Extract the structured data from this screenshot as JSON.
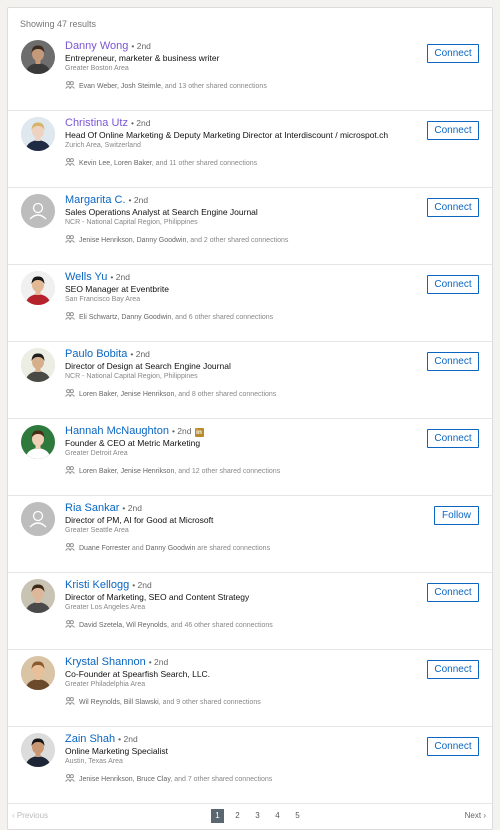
{
  "results_label": "Showing 47 results",
  "people": [
    {
      "name": "Danny Wong",
      "degree": "• 2nd",
      "headline": "Entrepreneur, marketer & business writer",
      "location": "Greater Boston Area",
      "shared_names": "Evan Weber, Josh Steimle",
      "shared_rest": ", and 13 other shared connections",
      "action": "Connect",
      "visited": true,
      "avatar": "photo",
      "skin": "#c49a7a",
      "hair": "#3b2a1f",
      "shirt": "#3a3a3a",
      "bg": "#6d6d6d"
    },
    {
      "name": "Christina Utz",
      "degree": "• 2nd",
      "headline": "Head Of Online Marketing & Deputy Marketing Director at Interdiscount / microspot.ch",
      "location": "Zurich Area, Switzerland",
      "shared_names": "Kevin Lee, Loren Baker",
      "shared_rest": ", and 11 other shared connections",
      "action": "Connect",
      "visited": true,
      "avatar": "photo",
      "skin": "#ecd2bf",
      "hair": "#d8b36a",
      "shirt": "#1f2a44",
      "bg": "#dfe7ef"
    },
    {
      "name": "Margarita C.",
      "degree": "• 2nd",
      "headline": "Sales Operations Analyst at Search Engine Journal",
      "location": "NCR - National Capital Region, Philippines",
      "shared_names": "Jenise Henrikson, Danny Goodwin",
      "shared_rest": ", and 2 other shared connections",
      "action": "Connect",
      "visited": false,
      "avatar": "placeholder"
    },
    {
      "name": "Wells Yu",
      "degree": "• 2nd",
      "headline": "SEO Manager at Eventbrite",
      "location": "San Francisco Bay Area",
      "shared_names": "Eli Schwartz, Danny Goodwin",
      "shared_rest": ", and 6 other shared connections",
      "action": "Connect",
      "visited": false,
      "avatar": "photo",
      "skin": "#e2b994",
      "hair": "#161616",
      "shirt": "#b5222b",
      "bg": "#f0f0f0"
    },
    {
      "name": "Paulo Bobita",
      "degree": "• 2nd",
      "headline": "Director of Design at Search Engine Journal",
      "location": "NCR - National Capital Region, Philippines",
      "shared_names": "Loren Baker, Jenise Henrikson",
      "shared_rest": ", and 8 other shared connections",
      "action": "Connect",
      "visited": false,
      "avatar": "photo",
      "skin": "#d6b08c",
      "hair": "#1e1e1e",
      "shirt": "#4a4a44",
      "bg": "#eceee4"
    },
    {
      "name": "Hannah McNaughton",
      "degree": "• 2nd",
      "headline": "Founder & CEO at Metric Marketing",
      "location": "Greater Detroit Area",
      "shared_names": "Loren Baker, Jenise Henrikson",
      "shared_rest": ", and 12 other shared connections",
      "action": "Connect",
      "visited": false,
      "avatar": "photo",
      "skin": "#efcfb6",
      "hair": "#4a2a18",
      "shirt": "#ffffff",
      "bg": "#2e7a3c",
      "badge": "in"
    },
    {
      "name": "Ria Sankar",
      "degree": "• 2nd",
      "headline": "Director of PM, AI for Good at Microsoft",
      "location": "Greater Seattle Area",
      "shared_names": "Duane Forrester",
      "shared_mid": " and ",
      "shared_names2": "Danny Goodwin",
      "shared_rest": " are shared connections",
      "action": "Follow",
      "visited": false,
      "avatar": "placeholder"
    },
    {
      "name": "Kristi Kellogg",
      "degree": "• 2nd",
      "headline": "Director of Marketing, SEO and Content Strategy",
      "location": "Greater Los Angeles Area",
      "shared_names": "David Szetela, Wil Reynolds",
      "shared_rest": ", and 46 other shared connections",
      "action": "Connect",
      "visited": false,
      "avatar": "photo",
      "skin": "#ddb79a",
      "hair": "#3a2818",
      "shirt": "#4a4a4a",
      "bg": "#c9c3b3"
    },
    {
      "name": "Krystal Shannon",
      "degree": "• 2nd",
      "headline": "Co-Founder at Spearfish Search, LLC.",
      "location": "Greater Philadelphia Area",
      "shared_names": "Wil Reynolds, Bill Slawski",
      "shared_rest": ", and 9 other shared connections",
      "action": "Connect",
      "visited": false,
      "avatar": "photo",
      "skin": "#e8bf98",
      "hair": "#8a5a2c",
      "shirt": "#6a4a2a",
      "bg": "#d9c4a6"
    },
    {
      "name": "Zain Shah",
      "degree": "• 2nd",
      "headline": "Online Marketing Specialist",
      "location": "Austin, Texas Area",
      "shared_names": "Jenise Henrikson, Bruce Clay",
      "shared_rest": ", and 7 other shared connections",
      "action": "Connect",
      "visited": false,
      "avatar": "photo",
      "skin": "#c99772",
      "hair": "#161616",
      "shirt": "#1c2636",
      "bg": "#dcdcdc"
    }
  ],
  "pagination": {
    "prev": "Previous",
    "next": "Next",
    "pages": [
      "1",
      "2",
      "3",
      "4",
      "5"
    ],
    "current": "1"
  },
  "colors": {
    "link": "#0a66c2",
    "visited": "#7b55d4",
    "page_active": "#5b6770"
  }
}
